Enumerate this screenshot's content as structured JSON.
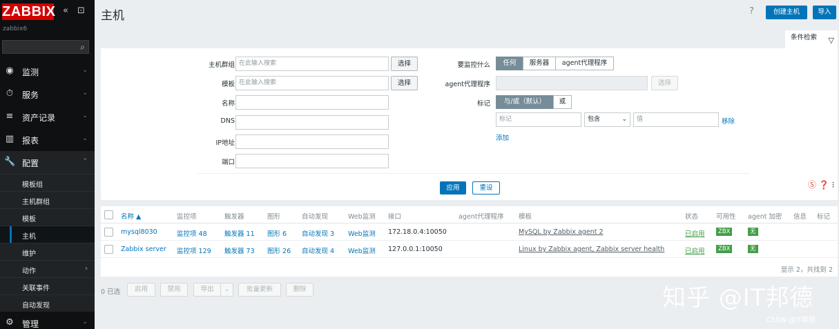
{
  "app": {
    "logo": "ZABBIX",
    "hostname": "zabbix6",
    "collapse_icon": "«",
    "kiosk_icon": "⊡"
  },
  "sidebar": {
    "items": [
      {
        "label": "监测",
        "icon": "eye-icon",
        "glyph": "◉",
        "chevron": "⌄"
      },
      {
        "label": "服务",
        "icon": "clock-icon",
        "glyph": "⏱",
        "chevron": "⌄"
      },
      {
        "label": "资产记录",
        "icon": "list-icon",
        "glyph": "≡",
        "chevron": "⌄"
      },
      {
        "label": "报表",
        "icon": "chart-icon",
        "glyph": "▥",
        "chevron": "⌄"
      },
      {
        "label": "配置",
        "icon": "wrench-icon",
        "glyph": "🔧",
        "chevron": "⌃"
      }
    ],
    "sub_items": [
      "模板组",
      "主机群组",
      "模板",
      "主机",
      "维护",
      "动作",
      "关联事件",
      "自动发现"
    ],
    "active_sub": "主机",
    "manage": {
      "label": "管理",
      "icon": "gear-icon",
      "glyph": "⚙",
      "chevron": "⌄"
    }
  },
  "header": {
    "title": "主机",
    "help": "?",
    "create_button": "创建主机",
    "import_button": "导入",
    "filter_tab": "条件检索"
  },
  "filter": {
    "host_groups_label": "主机群组",
    "host_groups_placeholder": "在此输入搜索",
    "templates_label": "模板",
    "templates_placeholder": "在此输入搜索",
    "name_label": "名称",
    "dns_label": "DNS",
    "ip_label": "IP地址",
    "port_label": "端口",
    "select_button": "选择",
    "monitored_by_label": "要监控什么",
    "monitored_by_options": [
      "任何",
      "服务器",
      "agent代理程序"
    ],
    "proxy_label": "agent代理程序",
    "proxy_select": "选择",
    "tags_label": "标记",
    "tags_logic": [
      "与/或（默认）",
      "或"
    ],
    "tag_placeholder": "标记",
    "tag_operator": "包含",
    "tag_value_placeholder": "值",
    "remove_link": "移除",
    "add_link": "添加",
    "apply_button": "应用",
    "reset_button": "重设"
  },
  "table": {
    "headers": [
      "名称 ▲",
      "监控项",
      "触发器",
      "图形",
      "自动发现",
      "Web监测",
      "接口",
      "agent代理程序",
      "模板",
      "状态",
      "可用性",
      "agent 加密",
      "信息",
      "标记"
    ],
    "rows": [
      {
        "name": "mysql8030",
        "items": "监控项 48",
        "triggers": "触发器 11",
        "graphs": "图形 6",
        "discovery": "自动发现 3",
        "web": "Web监测",
        "interface": "172.18.0.4:10050",
        "template": "MySQL by Zabbix agent 2",
        "status": "已启用",
        "availability": "ZBX",
        "encryption": "无"
      },
      {
        "name": "Zabbix server",
        "items": "监控项 129",
        "triggers": "触发器 73",
        "graphs": "图形 26",
        "discovery": "自动发现 4",
        "web": "Web监测",
        "interface": "127.0.0.1:10050",
        "template": "Linux by Zabbix agent, Zabbix server health",
        "status": "已启用",
        "availability": "ZBX",
        "encryption": "无"
      }
    ],
    "footer": "显示 2，共找到 2"
  },
  "bottom": {
    "selected": "0 已选",
    "buttons": [
      "启用",
      "禁用",
      "导出",
      "批量更新",
      "删除"
    ]
  },
  "watermark": "知乎 @IT邦德",
  "csdn": "CSDN @IT邦德",
  "colors": {
    "accent": "#0275b8",
    "logo_red": "#d40000",
    "status_green": "#429e47"
  }
}
